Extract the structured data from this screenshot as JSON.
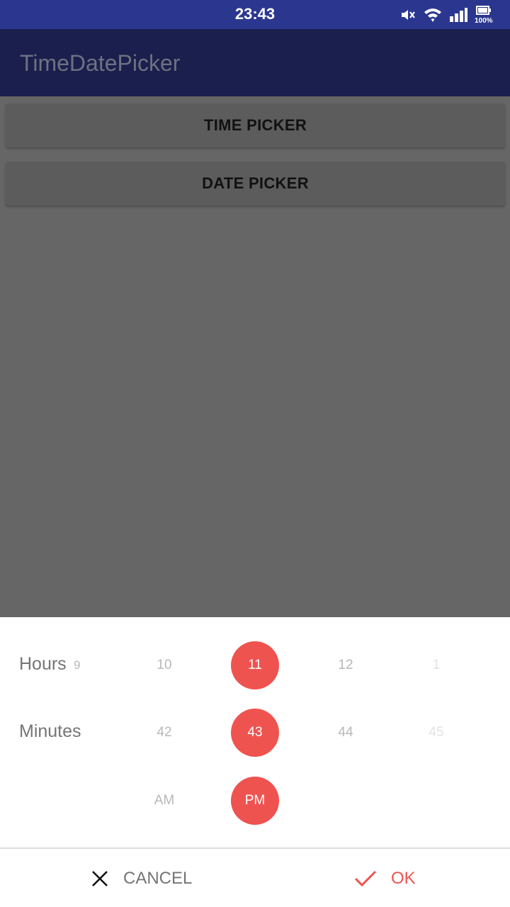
{
  "status_bar": {
    "time": "23:43",
    "battery": "100%"
  },
  "app_bar": {
    "title": "TimeDatePicker"
  },
  "buttons": {
    "time_picker": "TIME PICKER",
    "date_picker": "DATE PICKER"
  },
  "picker": {
    "hours_label": "Hours",
    "minutes_label": "Minutes",
    "hours": [
      "9",
      "10",
      "11",
      "12",
      "1"
    ],
    "minutes": [
      "42",
      "43",
      "44",
      "45"
    ],
    "ampm": [
      "AM",
      "PM"
    ],
    "selected": {
      "hour": "11",
      "minute": "43",
      "ampm": "PM"
    }
  },
  "actions": {
    "cancel": "CANCEL",
    "ok": "OK"
  },
  "colors": {
    "accent": "#ef5350",
    "status_bar": "#2b378f",
    "app_bar": "#1a1f4d"
  },
  "icons": [
    "mute-icon",
    "wifi-icon",
    "signal-icon",
    "battery-icon",
    "close-icon",
    "check-icon"
  ]
}
